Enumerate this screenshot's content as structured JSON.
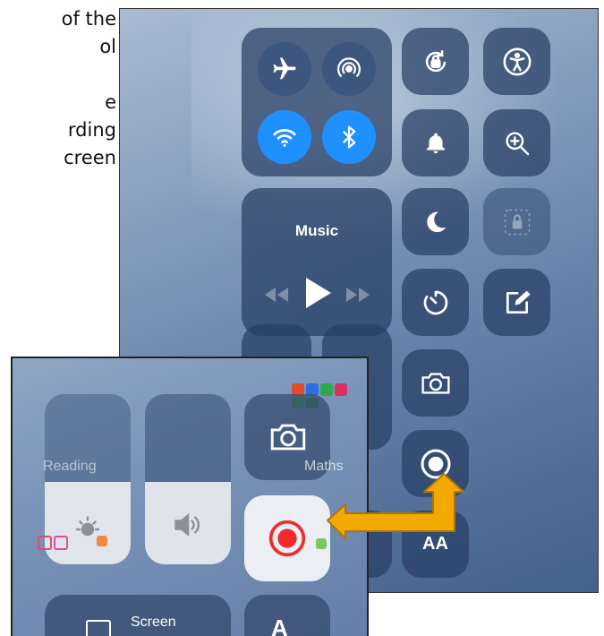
{
  "caption": {
    "lines": [
      "of the",
      "ol",
      "",
      "e",
      "rding",
      "creen"
    ]
  },
  "control_center": {
    "music_label": "Music",
    "icons": {
      "airplane": "airplane-icon",
      "airdrop": "airdrop-icon",
      "wifi": "wifi-icon",
      "bluetooth": "bluetooth-icon",
      "rotation_lock": "rotation-lock-icon",
      "accessibility": "accessibility-icon",
      "bell": "bell-icon",
      "magnifier": "magnifier-icon",
      "moon": "moon-icon",
      "lock": "lock-icon",
      "timer": "timer-icon",
      "notes": "notes-icon",
      "camera": "camera-icon",
      "record": "screen-record-icon"
    },
    "bottom_label": "AA",
    "accent_color": "#1e90ff"
  },
  "inset": {
    "label_reading": "Reading",
    "label_maths": "Maths",
    "label_screen": "Screen",
    "icons": {
      "camera": "camera-icon",
      "brightness": "brightness-icon",
      "volume": "volume-icon",
      "record": "screen-record-icon"
    },
    "record_color": "#ef2b2b"
  },
  "arrow_color": "#f2a900"
}
